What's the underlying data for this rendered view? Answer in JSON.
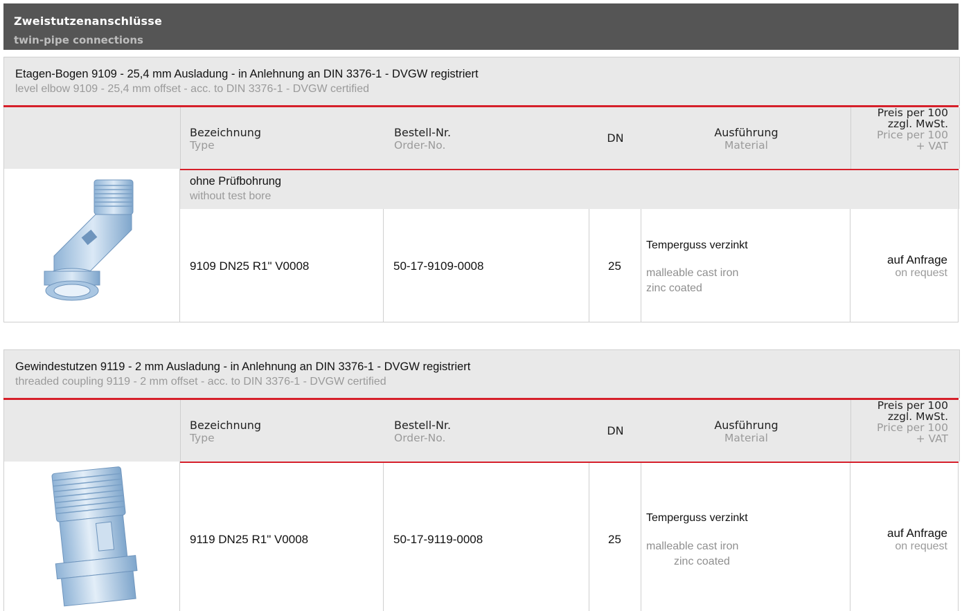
{
  "header": {
    "title_de": "Zweistutzenanschlüsse",
    "title_en": "twin-pipe connections"
  },
  "columns": {
    "type_de": "Bezeichnung",
    "type_en": "Type",
    "order_de": "Bestell-Nr.",
    "order_en": "Order-No.",
    "dn": "DN",
    "material_de": "Ausführung",
    "material_en": "Material",
    "price_de_1": "Preis per 100",
    "price_de_2": "zzgl. MwSt.",
    "price_en_1": "Price per 100",
    "price_en_2": "+ VAT"
  },
  "sections": [
    {
      "title_de": "Etagen-Bogen 9109 - 25,4 mm Ausladung - in Anlehnung an DIN 3376-1 - DVGW registriert",
      "title_en": "level elbow 9109 - 25,4 mm offset - acc. to DIN 3376-1 - DVGW certified",
      "subheading_de": "ohne Prüfbohrung",
      "subheading_en": "without test bore",
      "row": {
        "type": "9109 DN25 R1\" V0008",
        "order_no": "50-17-9109-0008",
        "dn": "25",
        "material_de": "Temperguss verzinkt",
        "material_en_1": "malleable cast iron",
        "material_en_2": "zinc coated",
        "price_de": "auf Anfrage",
        "price_en": "on request"
      },
      "image_icon": "level-elbow-fitting"
    },
    {
      "title_de": "Gewindestutzen 9119 - 2 mm Ausladung - in Anlehnung an DIN 3376-1 - DVGW registriert",
      "title_en": "threaded coupling 9119 - 2 mm offset - acc. to DIN 3376-1 - DVGW certified",
      "row": {
        "type": "9119 DN25 R1\" V0008",
        "order_no": "50-17-9119-0008",
        "dn": "25",
        "material_de": "Temperguss verzinkt",
        "material_en_1": "malleable cast iron",
        "material_en_2": "zinc coated",
        "price_de": "auf Anfrage",
        "price_en": "on request"
      },
      "image_icon": "threaded-coupling-fitting"
    }
  ],
  "colors": {
    "header_bg": "#555555",
    "accent_red": "#d61f2a",
    "panel_grey": "#e9e9e9",
    "fitting_blue": "#b9d3ea"
  }
}
